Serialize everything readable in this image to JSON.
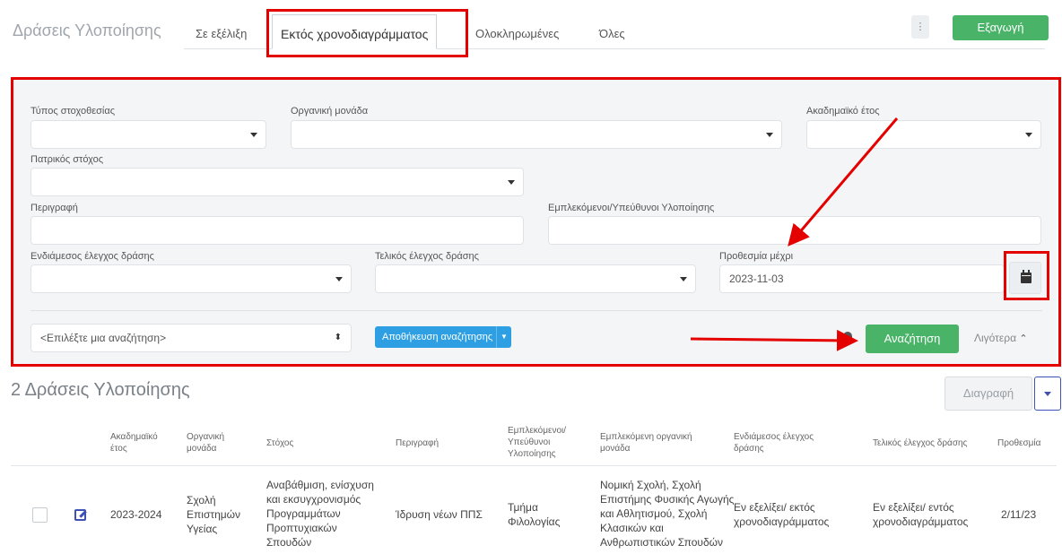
{
  "header": {
    "title": "Δράσεις Υλοποίησης",
    "tabs": [
      "Σε εξέλιξη",
      "Εκτός χρονοδιαγράμματος",
      "Ολοκληρωμένες",
      "Όλες"
    ],
    "kebab_icon": "⋮",
    "export_label": "Εξαγωγή"
  },
  "filters": {
    "target_type_label": "Τύπος στοχοθεσίας",
    "org_unit_label": "Οργανική μονάδα",
    "academic_year_label": "Ακαδημαϊκό έτος",
    "parent_goal_label": "Πατρικός στόχος",
    "description_label": "Περιγραφή",
    "involved_label": "Εμπλεκόμενοι/Υπεύθυνοι Υλοποίησης",
    "interim_check_label": "Ενδιάμεσος έλεγχος δράσης",
    "final_check_label": "Τελικός έλεγχος δράσης",
    "deadline_label": "Προθεσμία μέχρι",
    "deadline_value": "2023-11-03",
    "saved_search_placeholder": "<Επιλέξτε μια αναζήτηση>",
    "updown_icon": "⬍",
    "save_search_label": "Αποθήκευση αναζήτησης",
    "dropdown_icon": "▼",
    "search_label": "Αναζήτηση",
    "less_label": "Λιγότερα",
    "chevron_up_icon": "⌃"
  },
  "results": {
    "title": "2 Δράσεις Υλοποίησης",
    "delete_label": "Διαγραφή",
    "columns": [
      "Ακαδημαϊκό έτος",
      "Οργανική μονάδα",
      "Στόχος",
      "Περιγραφή",
      "Εμπλεκόμενοι/ Υπεύθυνοι Υλοποίησης",
      "Εμπλεκόμενη οργανική μονάδα",
      "Ενδιάμεσος έλεγχος δράσης",
      "Τελικός έλεγχος δράσης",
      "Προθεσμία"
    ],
    "rows": [
      {
        "year": "2023-2024",
        "unit": "Σχολή Επιστημών Υγείας",
        "goal": "Αναβάθμιση, ενίσχυση και εκσυγχρονισμός Προγραμμάτων Προπτυχιακών Σπουδών",
        "description": "Ίδρυση νέων ΠΠΣ",
        "involved": "Τμήμα Φιλολογίας",
        "involved_unit": "Νομική Σχολή, Σχολή Επιστήμης Φυσικής Αγωγής και Αθλητισμού, Σχολή Κλασικών και Ανθρωπιστικών Σπουδών",
        "interim": "Εν εξελίξει/ εκτός χρονοδιαγράμματος",
        "final": "Εν εξελίξει/ εντός χρονοδιαγράμματος",
        "deadline": "2/11/23"
      }
    ]
  },
  "colors": {
    "highlight": "#e50000",
    "green": "#49b368",
    "blue": "#2d9fe2",
    "indigo": "#3f51b5"
  }
}
